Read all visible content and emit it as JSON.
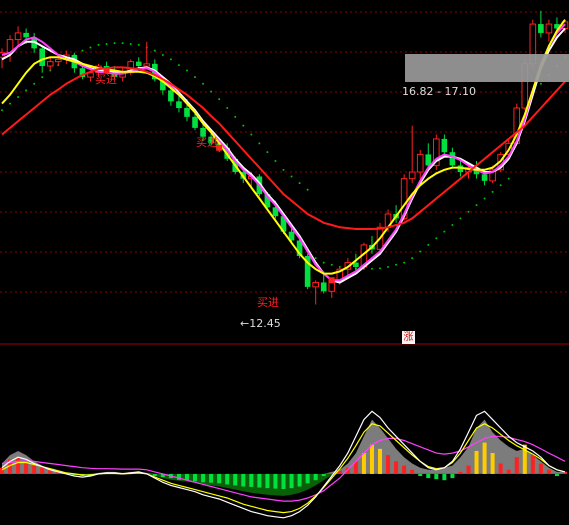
{
  "chart_data": [
    {
      "type": "candlestick",
      "panel": "price",
      "colors": {
        "up": "#ff2020",
        "down": "#00e040",
        "flat": "#ffffff",
        "ma_white": "#ffffff",
        "ma_magenta": "#ff40ff",
        "ma_yellow": "#ffff00",
        "ma_red": "#ff1a1a",
        "sar_dots": "#00c000",
        "grid": "#8b0000",
        "highlight": "#9a9a9a"
      },
      "candles": [
        [
          18.05,
          18.25,
          17.8,
          18.15
        ],
        [
          18.15,
          18.55,
          17.95,
          18.45
        ],
        [
          18.45,
          18.75,
          18.3,
          18.6
        ],
        [
          18.6,
          18.7,
          18.35,
          18.5
        ],
        [
          18.5,
          18.6,
          18.15,
          18.25
        ],
        [
          18.25,
          18.3,
          17.7,
          17.85
        ],
        [
          17.85,
          18.05,
          17.75,
          17.95
        ],
        [
          17.95,
          18.1,
          17.85,
          18.0
        ],
        [
          18.0,
          18.2,
          17.9,
          18.1
        ],
        [
          18.1,
          18.15,
          17.7,
          17.8
        ],
        [
          17.8,
          17.9,
          17.55,
          17.6
        ],
        [
          17.6,
          17.75,
          17.5,
          17.7
        ],
        [
          17.7,
          17.9,
          17.6,
          17.85
        ],
        [
          17.85,
          17.95,
          17.7,
          17.75
        ],
        [
          17.75,
          17.85,
          17.55,
          17.6
        ],
        [
          17.6,
          17.8,
          17.5,
          17.7
        ],
        [
          17.7,
          18.0,
          17.65,
          17.95
        ],
        [
          17.95,
          18.05,
          17.8,
          17.85
        ],
        [
          17.85,
          18.4,
          17.8,
          17.9
        ],
        [
          17.9,
          18.0,
          17.5,
          17.55
        ],
        [
          17.55,
          17.6,
          17.2,
          17.3
        ],
        [
          17.3,
          17.45,
          16.95,
          17.05
        ],
        [
          17.05,
          17.2,
          16.8,
          16.9
        ],
        [
          16.9,
          17.1,
          16.6,
          16.7
        ],
        [
          16.7,
          16.85,
          16.4,
          16.45
        ],
        [
          16.45,
          16.55,
          16.15,
          16.25
        ],
        [
          16.25,
          16.4,
          16.05,
          16.1
        ],
        [
          16.1,
          16.2,
          15.9,
          16.0
        ],
        [
          16.0,
          16.1,
          15.7,
          15.75
        ],
        [
          15.75,
          15.8,
          15.4,
          15.45
        ],
        [
          15.45,
          15.55,
          15.2,
          15.3
        ],
        [
          15.3,
          15.45,
          15.1,
          15.35
        ],
        [
          15.35,
          15.4,
          14.9,
          14.95
        ],
        [
          14.95,
          15.0,
          14.6,
          14.65
        ],
        [
          14.65,
          14.8,
          14.4,
          14.45
        ],
        [
          14.45,
          14.5,
          14.05,
          14.1
        ],
        [
          14.1,
          14.2,
          13.85,
          13.9
        ],
        [
          13.9,
          14.0,
          13.5,
          13.55
        ],
        [
          13.55,
          13.6,
          12.8,
          12.85
        ],
        [
          12.85,
          13.0,
          12.45,
          12.95
        ],
        [
          12.95,
          13.2,
          12.7,
          12.75
        ],
        [
          12.75,
          13.05,
          12.6,
          13.0
        ],
        [
          13.0,
          13.3,
          12.9,
          13.25
        ],
        [
          13.25,
          13.5,
          13.1,
          13.4
        ],
        [
          13.4,
          13.6,
          13.2,
          13.3
        ],
        [
          13.3,
          13.85,
          13.25,
          13.8
        ],
        [
          13.8,
          14.0,
          13.6,
          13.7
        ],
        [
          13.7,
          14.3,
          13.65,
          14.2
        ],
        [
          14.2,
          14.6,
          14.1,
          14.5
        ],
        [
          14.5,
          14.7,
          14.3,
          14.4
        ],
        [
          14.4,
          15.4,
          14.35,
          15.3
        ],
        [
          15.3,
          16.5,
          15.2,
          15.45
        ],
        [
          15.45,
          15.95,
          15.3,
          15.85
        ],
        [
          15.85,
          16.1,
          15.5,
          15.6
        ],
        [
          15.6,
          16.3,
          15.5,
          16.2
        ],
        [
          16.2,
          16.3,
          15.8,
          15.9
        ],
        [
          15.9,
          16.0,
          15.55,
          15.6
        ],
        [
          15.6,
          15.75,
          15.35,
          15.45
        ],
        [
          15.45,
          15.65,
          15.3,
          15.55
        ],
        [
          15.55,
          15.7,
          15.3,
          15.4
        ],
        [
          15.4,
          15.5,
          15.15,
          15.25
        ],
        [
          15.25,
          15.6,
          15.2,
          15.5
        ],
        [
          15.5,
          15.9,
          15.45,
          15.85
        ],
        [
          15.85,
          16.2,
          15.8,
          16.1
        ],
        [
          16.1,
          17.0,
          16.05,
          16.9
        ],
        [
          16.9,
          18.0,
          16.85,
          17.9
        ],
        [
          17.9,
          18.9,
          17.8,
          18.8
        ],
        [
          18.8,
          19.1,
          18.5,
          18.6
        ],
        [
          18.6,
          18.9,
          18.4,
          18.8
        ],
        [
          18.8,
          18.95,
          18.6,
          18.7
        ],
        [
          18.7,
          18.9,
          18.6,
          18.85
        ]
      ],
      "moving_averages": [
        {
          "color": "white",
          "values": [
            18.0,
            18.1,
            18.3,
            18.4,
            18.4,
            18.3,
            18.2,
            18.1,
            18.05,
            18.0,
            17.9,
            17.8,
            17.75,
            17.75,
            17.72,
            17.7,
            17.75,
            17.8,
            17.82,
            17.75,
            17.6,
            17.45,
            17.25,
            17.05,
            16.85,
            16.6,
            16.4,
            16.2,
            16.0,
            15.75,
            15.55,
            15.4,
            15.2,
            14.95,
            14.75,
            14.5,
            14.25,
            14.0,
            13.7,
            13.4,
            13.15,
            13.0,
            12.95,
            13.05,
            13.15,
            13.3,
            13.45,
            13.6,
            13.85,
            14.1,
            14.45,
            14.85,
            15.2,
            15.5,
            15.7,
            15.8,
            15.8,
            15.75,
            15.65,
            15.55,
            15.45,
            15.45,
            15.55,
            15.75,
            16.1,
            16.6,
            17.2,
            17.8,
            18.2,
            18.5,
            18.7
          ]
        },
        {
          "color": "magenta",
          "values": [
            18.1,
            18.15,
            18.3,
            18.45,
            18.5,
            18.4,
            18.25,
            18.1,
            18.0,
            17.95,
            17.85,
            17.78,
            17.72,
            17.7,
            17.68,
            17.68,
            17.72,
            17.78,
            17.8,
            17.72,
            17.55,
            17.4,
            17.2,
            17.0,
            16.8,
            16.55,
            16.35,
            16.15,
            15.95,
            15.7,
            15.5,
            15.35,
            15.15,
            14.9,
            14.7,
            14.45,
            14.2,
            13.95,
            13.65,
            13.35,
            13.15,
            13.0,
            13.0,
            13.1,
            13.2,
            13.35,
            13.5,
            13.65,
            13.9,
            14.15,
            14.5,
            14.9,
            15.25,
            15.55,
            15.75,
            15.85,
            15.8,
            15.72,
            15.6,
            15.5,
            15.42,
            15.45,
            15.6,
            15.8,
            16.15,
            16.65,
            17.3,
            17.9,
            18.3,
            18.6,
            18.8
          ]
        },
        {
          "color": "yellow",
          "values": [
            17.0,
            17.2,
            17.45,
            17.7,
            17.9,
            18.0,
            18.05,
            18.05,
            18.0,
            17.95,
            17.9,
            17.85,
            17.8,
            17.78,
            17.75,
            17.72,
            17.72,
            17.72,
            17.7,
            17.62,
            17.5,
            17.35,
            17.2,
            17.0,
            16.8,
            16.55,
            16.35,
            16.1,
            15.85,
            15.6,
            15.35,
            15.1,
            14.85,
            14.6,
            14.35,
            14.1,
            13.85,
            13.6,
            13.4,
            13.25,
            13.15,
            13.15,
            13.2,
            13.3,
            13.45,
            13.6,
            13.75,
            13.95,
            14.2,
            14.45,
            14.7,
            14.95,
            15.15,
            15.3,
            15.42,
            15.5,
            15.55,
            15.55,
            15.52,
            15.5,
            15.5,
            15.55,
            15.7,
            15.95,
            16.3,
            16.75,
            17.3,
            17.85,
            18.3,
            18.65,
            18.9
          ]
        },
        {
          "color": "red",
          "values": [
            16.3,
            16.45,
            16.6,
            16.75,
            16.9,
            17.05,
            17.2,
            17.32,
            17.45,
            17.55,
            17.65,
            17.72,
            17.78,
            17.8,
            17.82,
            17.82,
            17.8,
            17.78,
            17.72,
            17.65,
            17.55,
            17.45,
            17.32,
            17.2,
            17.05,
            16.9,
            16.72,
            16.55,
            16.35,
            16.15,
            15.95,
            15.75,
            15.55,
            15.35,
            15.15,
            14.95,
            14.8,
            14.65,
            14.5,
            14.4,
            14.3,
            14.25,
            14.2,
            14.18,
            14.16,
            14.16,
            14.16,
            14.17,
            14.2,
            14.25,
            14.3,
            14.4,
            14.55,
            14.7,
            14.85,
            15.0,
            15.15,
            15.3,
            15.45,
            15.6,
            15.75,
            15.9,
            16.05,
            16.2,
            16.35,
            16.5,
            16.7,
            16.9,
            17.1,
            17.3,
            17.5
          ]
        }
      ],
      "annotations": [
        {
          "text": "买进",
          "index": 13,
          "price": 17.85
        },
        {
          "text": "买进",
          "index": 27,
          "price": 16.05
        },
        {
          "text": "买进",
          "index": 41,
          "price": 12.8
        },
        {
          "text": "←12.45",
          "index": 39,
          "price": 12.3
        },
        {
          "text": "16.82 - 17.10",
          "index": 62,
          "price": 17.1
        }
      ],
      "ylim": [
        12.1,
        19.3
      ]
    },
    {
      "type": "bar",
      "panel": "oscillator",
      "label": "涨",
      "histogram": [
        0.3,
        0.7,
        0.8,
        0.6,
        0.4,
        0.3,
        0.2,
        0.1,
        0.05,
        -0.05,
        -0.1,
        -0.08,
        0.04,
        0.06,
        0.05,
        0.02,
        0.08,
        0.1,
        0.05,
        -0.1,
        -0.15,
        -0.2,
        -0.28,
        -0.3,
        -0.35,
        -0.4,
        -0.42,
        -0.45,
        -0.5,
        -0.55,
        -0.6,
        -0.62,
        -0.65,
        -0.68,
        -0.7,
        -0.72,
        -0.68,
        -0.6,
        -0.45,
        -0.3,
        -0.1,
        0.05,
        0.15,
        0.3,
        0.6,
        1.0,
        1.4,
        1.2,
        0.9,
        0.6,
        0.4,
        0.2,
        -0.1,
        -0.2,
        -0.25,
        -0.3,
        -0.2,
        0.1,
        0.4,
        1.1,
        1.5,
        1.0,
        0.5,
        0.2,
        0.8,
        1.4,
        0.9,
        0.5,
        0.2,
        -0.1,
        0.1
      ],
      "gray_area": [
        0.5,
        0.9,
        1.1,
        0.9,
        0.6,
        0.4,
        0.2,
        0.1,
        0.0,
        0.0,
        0.0,
        0.0,
        0.05,
        0.1,
        0.1,
        0.05,
        0.1,
        0.1,
        0.05,
        0.0,
        0.0,
        0.0,
        0.0,
        0.0,
        0.0,
        0.0,
        0.0,
        0.0,
        0.0,
        0.0,
        0.0,
        0.0,
        0.0,
        0.0,
        0.0,
        0.0,
        0.0,
        0.0,
        0.0,
        0.0,
        0.0,
        0.1,
        0.2,
        0.5,
        1.0,
        1.8,
        2.6,
        2.2,
        1.7,
        1.2,
        0.8,
        0.5,
        0.3,
        0.2,
        0.2,
        0.3,
        0.4,
        0.8,
        1.3,
        2.2,
        2.6,
        2.0,
        1.6,
        1.3,
        1.1,
        1.2,
        0.9,
        0.6,
        0.3,
        0.1,
        0.1
      ],
      "white_line": [
        0.3,
        0.6,
        0.8,
        0.7,
        0.5,
        0.35,
        0.2,
        0.1,
        0.0,
        -0.1,
        -0.15,
        -0.1,
        0.0,
        0.05,
        0.05,
        0.0,
        0.05,
        0.1,
        0.0,
        -0.2,
        -0.4,
        -0.55,
        -0.65,
        -0.75,
        -0.85,
        -1.0,
        -1.1,
        -1.2,
        -1.35,
        -1.5,
        -1.65,
        -1.8,
        -1.9,
        -2.0,
        -2.05,
        -2.1,
        -2.0,
        -1.8,
        -1.5,
        -1.1,
        -0.6,
        -0.1,
        0.4,
        1.0,
        1.8,
        2.6,
        3.0,
        2.7,
        2.2,
        1.8,
        1.4,
        1.0,
        0.6,
        0.3,
        0.2,
        0.3,
        0.6,
        1.2,
        2.0,
        2.8,
        3.0,
        2.6,
        2.2,
        1.8,
        1.5,
        1.3,
        1.1,
        0.8,
        0.4,
        0.2,
        0.1
      ],
      "magenta_line": [
        0.5,
        0.55,
        0.6,
        0.62,
        0.6,
        0.55,
        0.5,
        0.45,
        0.4,
        0.35,
        0.3,
        0.27,
        0.25,
        0.25,
        0.24,
        0.23,
        0.23,
        0.23,
        0.2,
        0.1,
        0.0,
        -0.1,
        -0.2,
        -0.3,
        -0.4,
        -0.5,
        -0.6,
        -0.7,
        -0.8,
        -0.9,
        -1.0,
        -1.1,
        -1.15,
        -1.2,
        -1.25,
        -1.3,
        -1.3,
        -1.25,
        -1.15,
        -1.0,
        -0.8,
        -0.5,
        -0.2,
        0.2,
        0.6,
        1.0,
        1.4,
        1.6,
        1.7,
        1.7,
        1.6,
        1.45,
        1.3,
        1.15,
        1.0,
        0.95,
        1.0,
        1.1,
        1.3,
        1.5,
        1.7,
        1.8,
        1.8,
        1.75,
        1.65,
        1.55,
        1.4,
        1.2,
        1.0,
        0.8,
        0.6
      ],
      "yellow_line": [
        0.2,
        0.4,
        0.55,
        0.55,
        0.45,
        0.35,
        0.25,
        0.15,
        0.05,
        0.0,
        -0.05,
        -0.05,
        0.0,
        0.02,
        0.02,
        0.0,
        0.02,
        0.05,
        0.0,
        -0.15,
        -0.3,
        -0.45,
        -0.55,
        -0.65,
        -0.75,
        -0.85,
        -0.95,
        -1.05,
        -1.15,
        -1.3,
        -1.45,
        -1.55,
        -1.65,
        -1.75,
        -1.8,
        -1.85,
        -1.8,
        -1.65,
        -1.4,
        -1.05,
        -0.65,
        -0.2,
        0.25,
        0.75,
        1.35,
        2.0,
        2.4,
        2.3,
        1.95,
        1.6,
        1.25,
        0.9,
        0.6,
        0.35,
        0.25,
        0.3,
        0.55,
        1.0,
        1.6,
        2.2,
        2.4,
        2.2,
        1.9,
        1.6,
        1.35,
        1.15,
        0.95,
        0.7,
        0.4,
        0.2,
        0.1
      ],
      "ylim": [
        -2.3,
        3.3
      ]
    }
  ]
}
